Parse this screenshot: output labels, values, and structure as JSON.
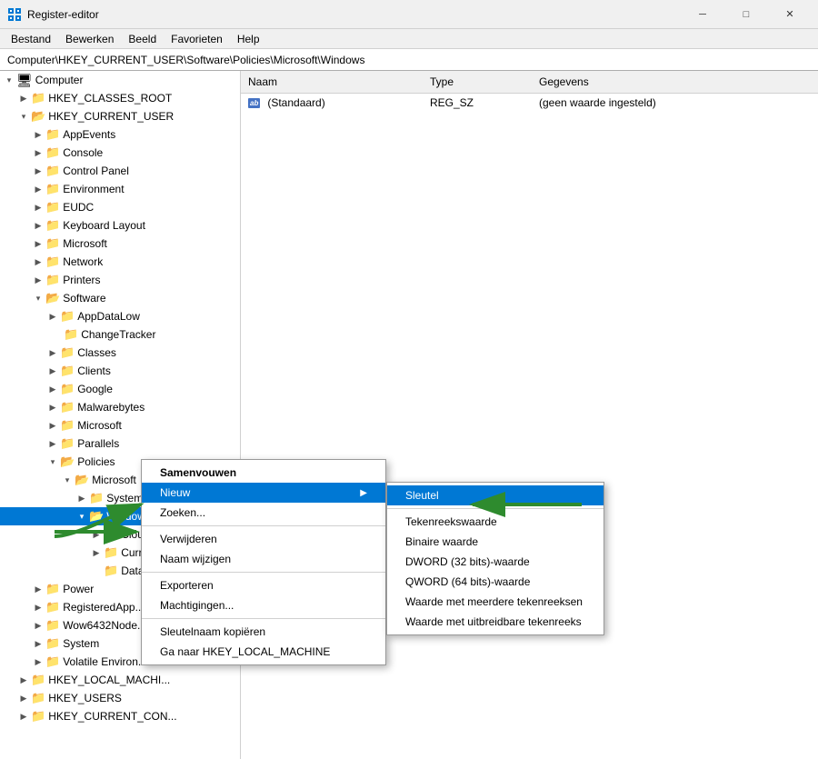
{
  "titleBar": {
    "icon": "🗂",
    "title": "Register-editor",
    "minBtn": "─",
    "maxBtn": "□",
    "closeBtn": "✕"
  },
  "menuBar": {
    "items": [
      "Bestand",
      "Bewerken",
      "Beeld",
      "Favorieten",
      "Help"
    ]
  },
  "addressBar": {
    "path": "Computer\\HKEY_CURRENT_USER\\Software\\Policies\\Microsoft\\Windows"
  },
  "detailPanel": {
    "columns": {
      "naam": "Naam",
      "type": "Type",
      "gegevens": "Gegevens"
    },
    "rows": [
      {
        "name": "(Standaard)",
        "type": "REG_SZ",
        "value": "(geen waarde ingesteld)",
        "icon": "ab"
      }
    ]
  },
  "tree": {
    "items": [
      {
        "id": "computer",
        "label": "Computer",
        "level": 0,
        "expanded": true,
        "icon": "💻"
      },
      {
        "id": "hkey_classes_root",
        "label": "HKEY_CLASSES_ROOT",
        "level": 1,
        "expanded": false
      },
      {
        "id": "hkey_current_user",
        "label": "HKEY_CURRENT_USER",
        "level": 1,
        "expanded": true
      },
      {
        "id": "appevents",
        "label": "AppEvents",
        "level": 2,
        "expanded": false
      },
      {
        "id": "console",
        "label": "Console",
        "level": 2,
        "expanded": false
      },
      {
        "id": "control_panel",
        "label": "Control Panel",
        "level": 2,
        "expanded": false
      },
      {
        "id": "environment",
        "label": "Environment",
        "level": 2,
        "expanded": false
      },
      {
        "id": "eudc",
        "label": "EUDC",
        "level": 2,
        "expanded": false
      },
      {
        "id": "keyboard_layout",
        "label": "Keyboard Layout",
        "level": 2,
        "expanded": false
      },
      {
        "id": "microsoft",
        "label": "Microsoft",
        "level": 2,
        "expanded": false
      },
      {
        "id": "network",
        "label": "Network",
        "level": 2,
        "expanded": false
      },
      {
        "id": "printers",
        "label": "Printers",
        "level": 2,
        "expanded": false
      },
      {
        "id": "software",
        "label": "Software",
        "level": 2,
        "expanded": true
      },
      {
        "id": "appdatalow",
        "label": "AppDataLow",
        "level": 3,
        "expanded": false
      },
      {
        "id": "changetracker",
        "label": "ChangeTracker",
        "level": 3,
        "expanded": false
      },
      {
        "id": "classes",
        "label": "Classes",
        "level": 3,
        "expanded": false
      },
      {
        "id": "clients",
        "label": "Clients",
        "level": 3,
        "expanded": false
      },
      {
        "id": "google",
        "label": "Google",
        "level": 3,
        "expanded": false
      },
      {
        "id": "malwarebytes",
        "label": "Malwarebytes",
        "level": 3,
        "expanded": false
      },
      {
        "id": "microsoft2",
        "label": "Microsoft",
        "level": 3,
        "expanded": false
      },
      {
        "id": "parallels",
        "label": "Parallels",
        "level": 3,
        "expanded": false
      },
      {
        "id": "policies",
        "label": "Policies",
        "level": 3,
        "expanded": true
      },
      {
        "id": "microsoft_pol",
        "label": "Microsoft",
        "level": 4,
        "expanded": true
      },
      {
        "id": "systemcertificates",
        "label": "SystemCertificates",
        "level": 5,
        "expanded": false
      },
      {
        "id": "windows",
        "label": "Windows",
        "level": 5,
        "expanded": true,
        "selected": true
      },
      {
        "id": "cloudc",
        "label": "Cloudc...",
        "level": 6,
        "expanded": false
      },
      {
        "id": "curre",
        "label": "Curre...",
        "level": 6,
        "expanded": false
      },
      {
        "id": "datac",
        "label": "DataC...",
        "level": 6,
        "expanded": false
      },
      {
        "id": "power",
        "label": "Power",
        "level": 2,
        "expanded": false
      },
      {
        "id": "registeredapp",
        "label": "RegisteredApp...",
        "level": 2,
        "expanded": false
      },
      {
        "id": "wow6432node",
        "label": "Wow6432Node...",
        "level": 2,
        "expanded": false
      },
      {
        "id": "system",
        "label": "System",
        "level": 2,
        "expanded": false
      },
      {
        "id": "volatile_environ",
        "label": "Volatile Environ...",
        "level": 2,
        "expanded": false
      },
      {
        "id": "hkey_local_machi",
        "label": "HKEY_LOCAL_MACHI...",
        "level": 1,
        "expanded": false
      },
      {
        "id": "hkey_users",
        "label": "HKEY_USERS",
        "level": 1,
        "expanded": false
      },
      {
        "id": "hkey_current_con",
        "label": "HKEY_CURRENT_CON...",
        "level": 1,
        "expanded": false
      }
    ]
  },
  "contextMenu": {
    "items": [
      {
        "id": "samenvouwen",
        "label": "Samenvouwen",
        "bold": false,
        "separator": false,
        "hasSubmenu": false
      },
      {
        "id": "nieuw",
        "label": "Nieuw",
        "bold": false,
        "separator": false,
        "hasSubmenu": true,
        "highlighted": true
      },
      {
        "id": "zoeken",
        "label": "Zoeken...",
        "bold": false,
        "separator": false,
        "hasSubmenu": false
      },
      {
        "id": "sep1",
        "separator": true
      },
      {
        "id": "verwijderen",
        "label": "Verwijderen",
        "bold": false,
        "separator": false,
        "hasSubmenu": false
      },
      {
        "id": "naam_wijzigen",
        "label": "Naam wijzigen",
        "bold": false,
        "separator": false,
        "hasSubmenu": false
      },
      {
        "id": "sep2",
        "separator": true
      },
      {
        "id": "exporteren",
        "label": "Exporteren",
        "bold": false,
        "separator": false,
        "hasSubmenu": false
      },
      {
        "id": "machtigingen",
        "label": "Machtigingen...",
        "bold": false,
        "separator": false,
        "hasSubmenu": false
      },
      {
        "id": "sep3",
        "separator": true
      },
      {
        "id": "sleutelnaam",
        "label": "Sleutelnaam kopiëren",
        "bold": false,
        "separator": false,
        "hasSubmenu": false
      },
      {
        "id": "ga_naar",
        "label": "Ga naar HKEY_LOCAL_MACHINE",
        "bold": false,
        "separator": false,
        "hasSubmenu": false
      }
    ]
  },
  "subMenu": {
    "items": [
      {
        "id": "sleutel",
        "label": "Sleutel",
        "highlighted": true
      },
      {
        "id": "sep1",
        "separator": true
      },
      {
        "id": "tekenreekswaarde",
        "label": "Tekenreekswaarde"
      },
      {
        "id": "binaire_waarde",
        "label": "Binaire waarde"
      },
      {
        "id": "dword",
        "label": "DWORD (32 bits)-waarde"
      },
      {
        "id": "qword",
        "label": "QWORD (64 bits)-waarde"
      },
      {
        "id": "meerdere",
        "label": "Waarde met meerdere tekenreeksen"
      },
      {
        "id": "uitbreidbare",
        "label": "Waarde met uitbreidbare tekenreeks"
      }
    ]
  }
}
